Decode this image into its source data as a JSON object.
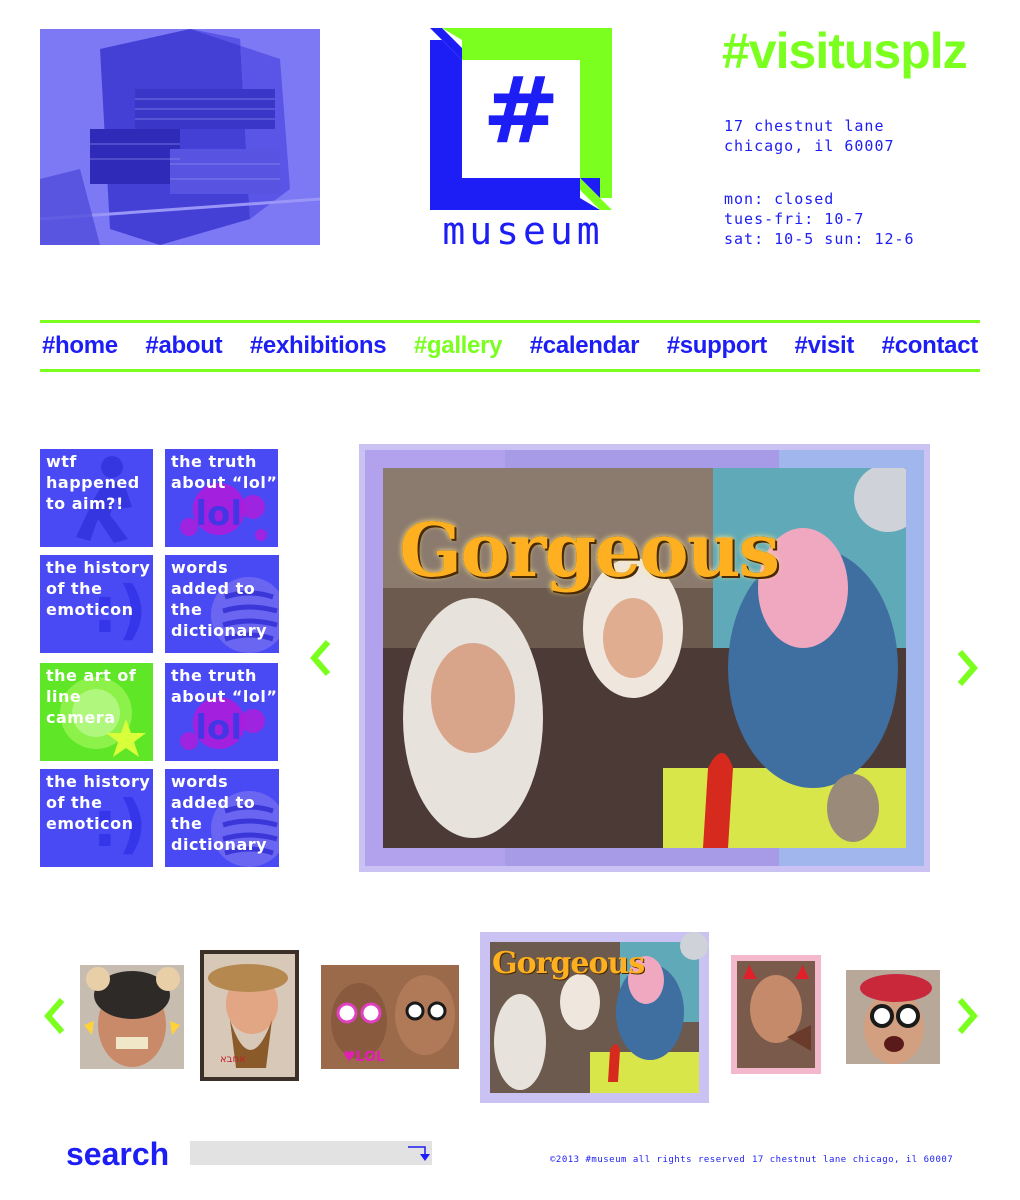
{
  "header": {
    "logo_word": "museum",
    "logo_symbol": "#",
    "tagline": "#visitusplz",
    "address_line1": "17 chestnut lane",
    "address_line2": "chicago, il 60007",
    "hours_line1": "mon: closed",
    "hours_line2": "tues-fri: 10-7",
    "hours_line3": "sat: 10-5 sun: 12-6"
  },
  "nav": {
    "items": [
      {
        "label": "#home"
      },
      {
        "label": "#about"
      },
      {
        "label": "#exhibitions"
      },
      {
        "label": "#gallery",
        "active": true
      },
      {
        "label": "#calendar"
      },
      {
        "label": "#support"
      },
      {
        "label": "#visit"
      },
      {
        "label": "#contact"
      }
    ]
  },
  "tiles": [
    {
      "label": "wtf happened to aim?!",
      "icon": "aim-runner-icon"
    },
    {
      "label": "the truth about “lol”",
      "icon": "lol-icon",
      "deco": "lol"
    },
    {
      "label": "the history of the emoticon",
      "icon": "emoticon-icon",
      "deco": ":)"
    },
    {
      "label": "words added to the dictionary",
      "icon": "dictionary-icon"
    },
    {
      "label": "the art of line camera",
      "icon": "line-camera-icon"
    },
    {
      "label": "the truth about “lol”",
      "icon": "lol-icon",
      "deco": "lol"
    },
    {
      "label": "the history of the emoticon",
      "icon": "emoticon-icon",
      "deco": ":)"
    },
    {
      "label": "words added to the dictionary",
      "icon": "dictionary-icon"
    }
  ],
  "slideshow": {
    "caption_word": "Gorgeous",
    "thumb_text_1": "אחבא",
    "thumb_text_2": "♥LOL"
  },
  "search": {
    "label": "search",
    "placeholder": ""
  },
  "footer": {
    "copyright": "©2013 #museum all rights reserved",
    "address": "17 chestnut lane chicago, il 60007"
  },
  "colors": {
    "brand_blue": "#1d1df5",
    "accent_green": "#7bff1f"
  }
}
